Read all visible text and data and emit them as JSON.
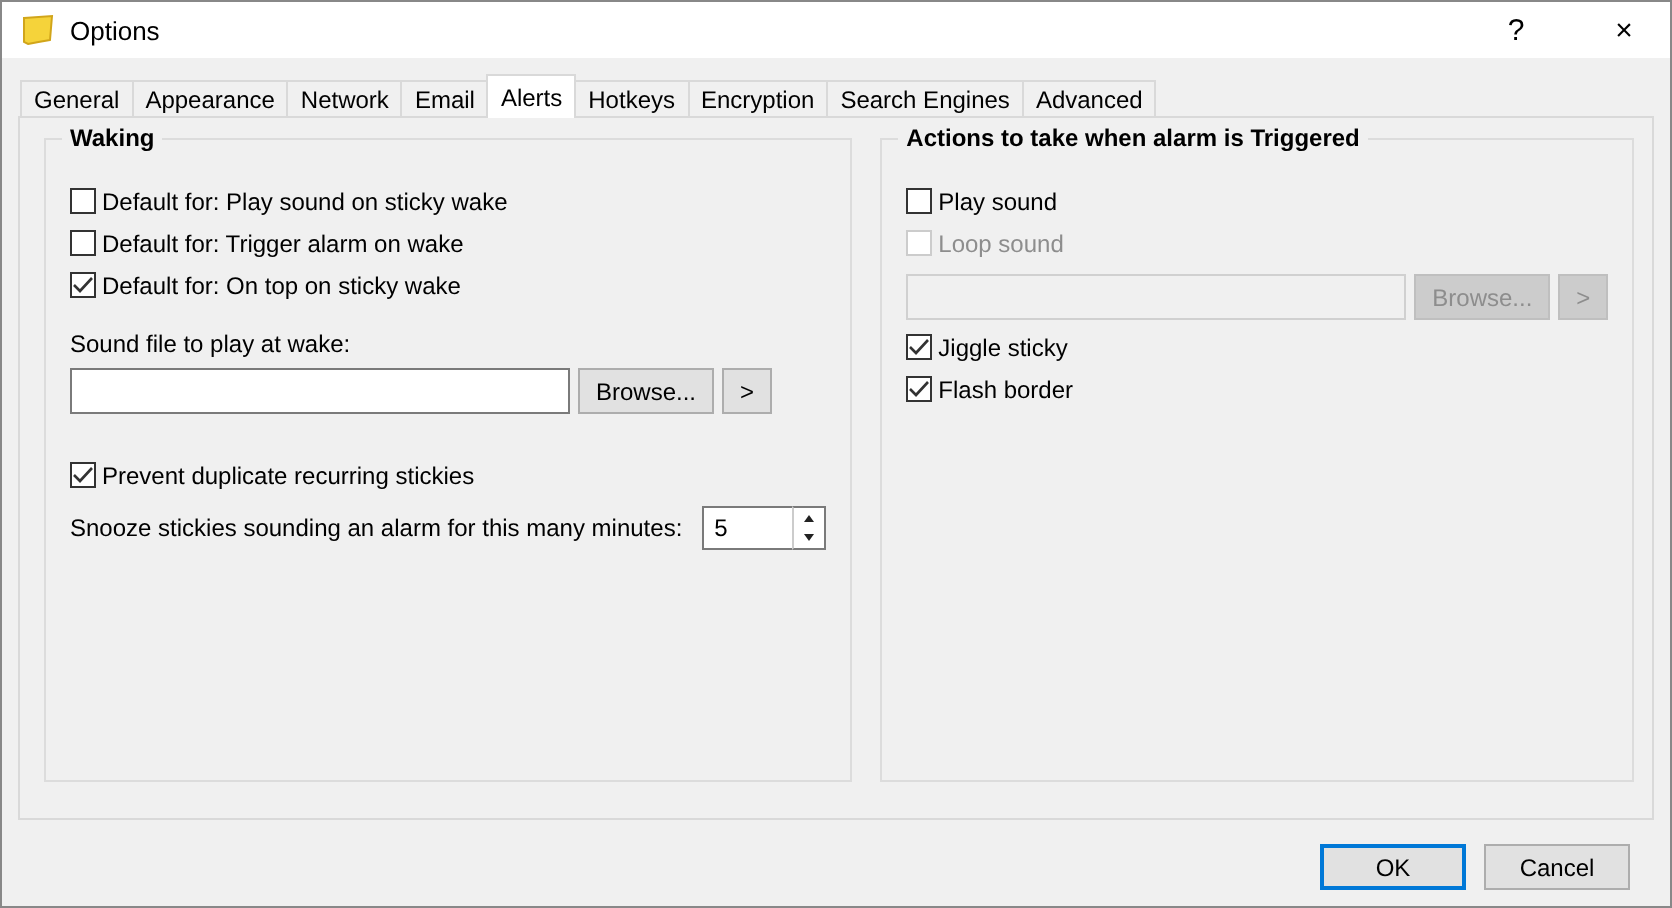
{
  "window": {
    "title": "Options",
    "help": "?",
    "close": "×"
  },
  "tabs": [
    {
      "label": "General",
      "selected": false
    },
    {
      "label": "Appearance",
      "selected": false
    },
    {
      "label": "Network",
      "selected": false
    },
    {
      "label": "Email",
      "selected": false
    },
    {
      "label": "Alerts",
      "selected": true
    },
    {
      "label": "Hotkeys",
      "selected": false
    },
    {
      "label": "Encryption",
      "selected": false
    },
    {
      "label": "Search Engines",
      "selected": false
    },
    {
      "label": "Advanced",
      "selected": false
    }
  ],
  "waking": {
    "title": "Waking",
    "items": [
      {
        "kind": "checkbox",
        "label": "Default for: Play sound on sticky wake",
        "checked": false,
        "disabled": false
      },
      {
        "kind": "checkbox",
        "label": "Default for: Trigger alarm on wake",
        "checked": false,
        "disabled": false
      },
      {
        "kind": "checkbox",
        "label": "Default for: On top on sticky wake",
        "checked": true,
        "disabled": false
      },
      {
        "kind": "file",
        "label": "Sound file to play at wake:",
        "browse": "Browse...",
        "go": ">",
        "disabled": false
      },
      {
        "kind": "checkbox",
        "label": "Prevent duplicate recurring stickies",
        "checked": true,
        "disabled": false
      },
      {
        "kind": "spin",
        "label": "Snooze stickies sounding an alarm for this many minutes:",
        "value": "5"
      }
    ]
  },
  "actions": {
    "title": "Actions to take when alarm is Triggered",
    "items": [
      {
        "kind": "checkbox",
        "label": "Play sound",
        "checked": false,
        "disabled": false
      },
      {
        "kind": "checkbox",
        "label": "Loop sound",
        "checked": false,
        "disabled": true
      },
      {
        "kind": "file",
        "browse": "Browse...",
        "go": ">",
        "disabled": true
      },
      {
        "kind": "checkbox",
        "label": "Jiggle sticky",
        "checked": true,
        "disabled": false
      },
      {
        "kind": "checkbox",
        "label": "Flash border",
        "checked": true,
        "disabled": false
      }
    ]
  },
  "buttons": [
    {
      "label": "OK",
      "default": true
    },
    {
      "label": "Cancel",
      "default": false
    }
  ]
}
